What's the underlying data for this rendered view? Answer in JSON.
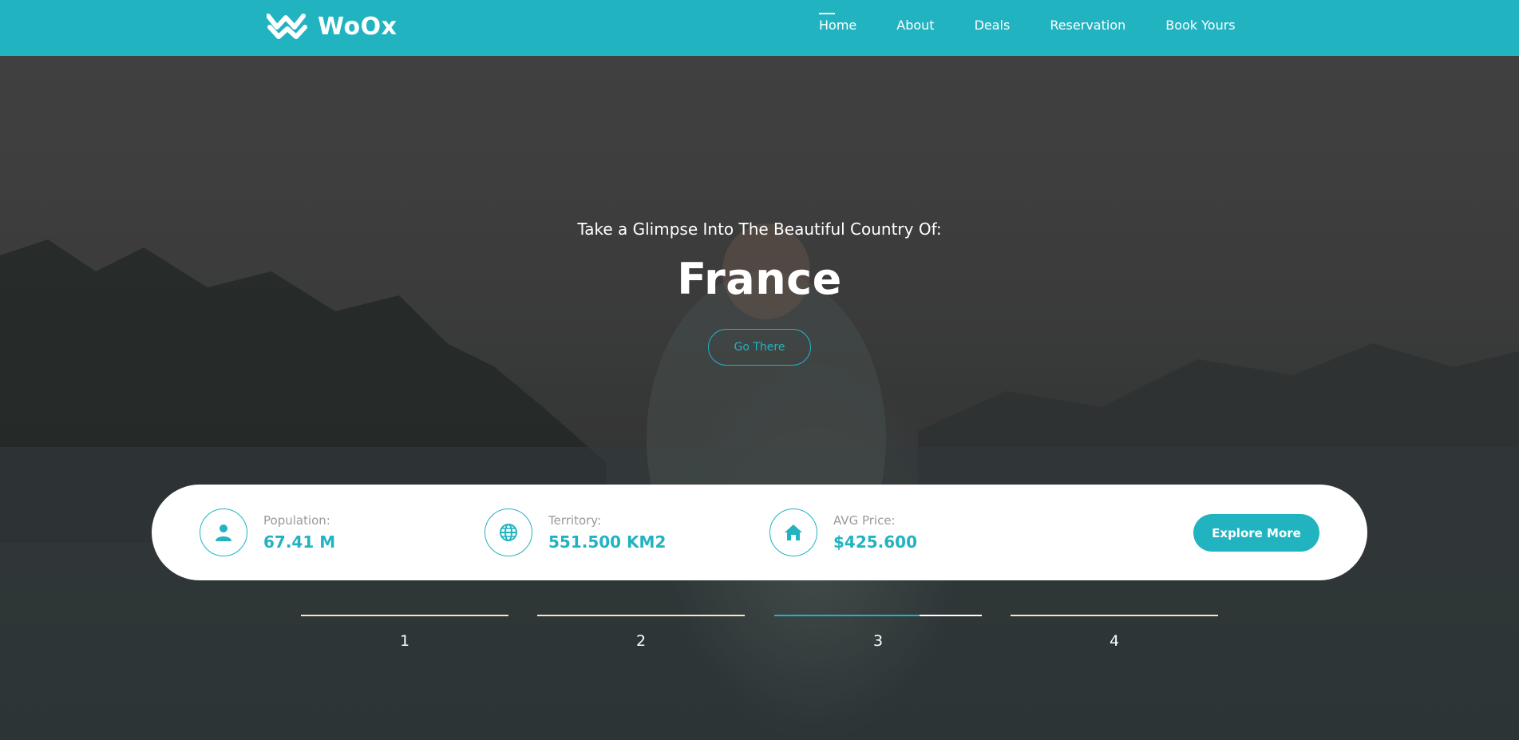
{
  "header": {
    "logo_text": "WoOx",
    "nav": [
      {
        "label": "Home",
        "active": true
      },
      {
        "label": "About"
      },
      {
        "label": "Deals"
      },
      {
        "label": "Reservation"
      },
      {
        "label": "Book Yours"
      }
    ]
  },
  "hero": {
    "subtitle": "Take a Glimpse Into The Beautiful Country Of:",
    "title": "France",
    "button_label": "Go There"
  },
  "stats": [
    {
      "label": "Population:",
      "value": "67.41 M",
      "icon": "user-icon"
    },
    {
      "label": "Territory:",
      "value": "551.500 KM2",
      "icon": "globe-icon"
    },
    {
      "label": "AVG Price:",
      "value": "$425.600",
      "icon": "home-icon"
    }
  ],
  "explore_label": "Explore More",
  "pager": {
    "items": [
      "1",
      "2",
      "3",
      "4"
    ],
    "active_index": 2
  },
  "colors": {
    "accent": "#22b3c1",
    "pager_line": "#f2e8c7"
  }
}
